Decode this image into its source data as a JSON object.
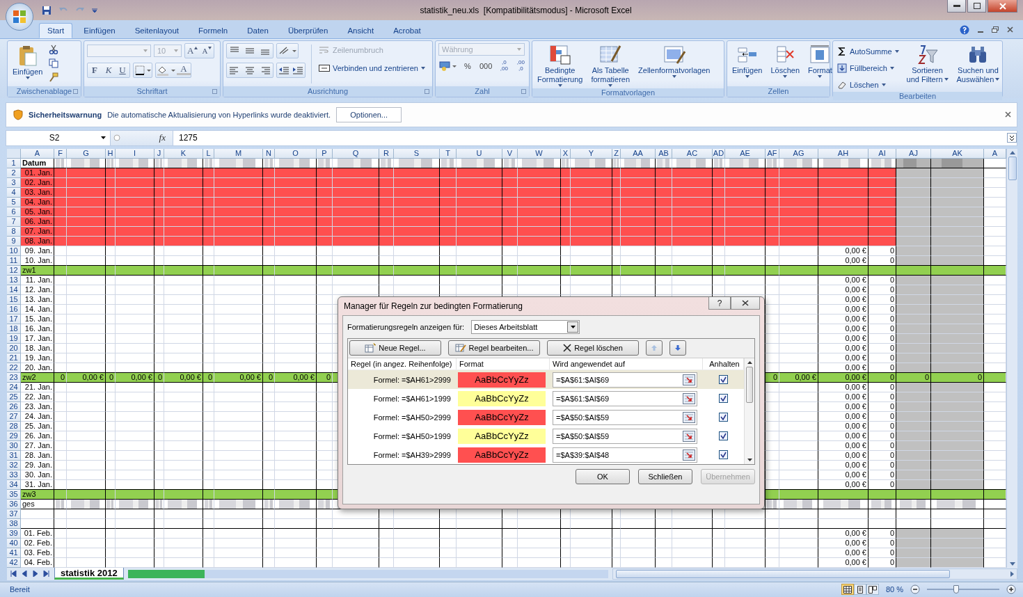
{
  "window": {
    "title": "statistik_neu.xls  [Kompatibilitätsmodus] - Microsoft Excel"
  },
  "ribbon": {
    "tabs": [
      {
        "label": "Start",
        "selected": true
      },
      {
        "label": "Einfügen",
        "selected": false
      },
      {
        "label": "Seitenlayout",
        "selected": false
      },
      {
        "label": "Formeln",
        "selected": false
      },
      {
        "label": "Daten",
        "selected": false
      },
      {
        "label": "Überprüfen",
        "selected": false
      },
      {
        "label": "Ansicht",
        "selected": false
      },
      {
        "label": "Acrobat",
        "selected": false
      }
    ],
    "clipboard": {
      "paste": "Einfügen",
      "label": "Zwischenablage"
    },
    "font": {
      "size": "10",
      "grow": "A",
      "shrink": "A",
      "bold": "F",
      "italic": "K",
      "underline": "U",
      "font_color": "A",
      "label": "Schriftart"
    },
    "alignment": {
      "wrap": {
        "label": "Zeilenumbruch",
        "disabled": true
      },
      "merge": {
        "label": "Verbinden und zentrieren",
        "disabled": false
      },
      "label": "Ausrichtung"
    },
    "number": {
      "format": {
        "value": "Währung",
        "disabled": true
      },
      "percent": "%",
      "thousands": "000",
      "increase_decimal": [
        ",0",
        ",00"
      ],
      "decrease_decimal": [
        ",00",
        ",0"
      ],
      "label": "Zahl"
    },
    "styles": {
      "buttons": [
        {
          "lines": [
            "Bedingte",
            "Formatierung"
          ],
          "kind": "conditional"
        },
        {
          "lines": [
            "Als Tabelle",
            "formatieren"
          ],
          "kind": "table"
        },
        {
          "lines": [
            "Zellenformatvorlagen"
          ],
          "kind": "cellstyle"
        }
      ],
      "label": "Formatvorlagen"
    },
    "cells": {
      "buttons": [
        {
          "label": "Einfügen",
          "kind": "insert"
        },
        {
          "label": "Löschen",
          "kind": "delete"
        },
        {
          "label": "Format",
          "kind": "format"
        }
      ],
      "label": "Zellen"
    },
    "editing": {
      "small": [
        {
          "label": "AutoSumme",
          "kind": "sum"
        },
        {
          "label": "Füllbereich",
          "kind": "fill"
        },
        {
          "label": "Löschen",
          "kind": "clear"
        }
      ],
      "big": [
        {
          "lines": [
            "Sortieren",
            "und Filtern"
          ],
          "kind": "sort"
        },
        {
          "lines": [
            "Suchen und",
            "Auswählen"
          ],
          "kind": "find"
        }
      ],
      "label": "Bearbeiten"
    }
  },
  "security_bar": {
    "title": "Sicherheitswarnung",
    "message": "Die automatische Aktualisierung von Hyperlinks wurde deaktiviert.",
    "button": "Optionen..."
  },
  "formula_bar": {
    "name_box": "S2",
    "function_label": "fx",
    "value": "1275"
  },
  "sheet": {
    "columns": [
      {
        "label": "A",
        "kind": "data"
      },
      {
        "label": "F",
        "kind": "data"
      },
      {
        "label": "G",
        "kind": "data"
      },
      {
        "label": "H",
        "kind": "data"
      },
      {
        "label": "I",
        "kind": "data"
      },
      {
        "label": "J",
        "kind": "data"
      },
      {
        "label": "K",
        "kind": "data"
      },
      {
        "label": "L",
        "kind": "data"
      },
      {
        "label": "M",
        "kind": "data"
      },
      {
        "label": "N",
        "kind": "data"
      },
      {
        "label": "O",
        "kind": "data"
      },
      {
        "label": "P",
        "kind": "data"
      },
      {
        "label": "Q",
        "kind": "data"
      },
      {
        "label": "R",
        "kind": "data"
      },
      {
        "label": "S",
        "kind": "data"
      },
      {
        "label": "T",
        "kind": "data"
      },
      {
        "label": "U",
        "kind": "data"
      },
      {
        "label": "V",
        "kind": "data"
      },
      {
        "label": "W",
        "kind": "data"
      },
      {
        "label": "X",
        "kind": "data"
      },
      {
        "label": "Y",
        "kind": "data"
      },
      {
        "label": "Z",
        "kind": "data"
      },
      {
        "label": "AA",
        "kind": "data"
      },
      {
        "label": "AB",
        "kind": "data"
      },
      {
        "label": "AC",
        "kind": "data"
      },
      {
        "label": "AD",
        "kind": "data"
      },
      {
        "label": "AE",
        "kind": "data"
      },
      {
        "label": "AF",
        "kind": "data"
      },
      {
        "label": "AG",
        "kind": "data"
      },
      {
        "label": "AH",
        "kind": "data"
      },
      {
        "label": "AI",
        "kind": "data"
      },
      {
        "label": "AJ",
        "kind": "shaded"
      },
      {
        "label": "AK",
        "kind": "shaded"
      },
      {
        "label": "A",
        "kind": "outside"
      }
    ],
    "rows": [
      {
        "number": "1",
        "kind": "header",
        "cells": [
          "Datum"
        ]
      },
      {
        "number": "2",
        "kind": "highlight",
        "cells": [
          "01. Jan."
        ]
      },
      {
        "number": "3",
        "kind": "highlight",
        "cells": [
          "02. Jan."
        ]
      },
      {
        "number": "4",
        "kind": "highlight",
        "cells": [
          "03. Jan."
        ]
      },
      {
        "number": "5",
        "kind": "highlight",
        "cells": [
          "04. Jan."
        ]
      },
      {
        "number": "6",
        "kind": "highlight",
        "cells": [
          "05. Jan."
        ]
      },
      {
        "number": "7",
        "kind": "highlight",
        "cells": [
          "06. Jan."
        ]
      },
      {
        "number": "8",
        "kind": "highlight",
        "cells": [
          "07. Jan."
        ]
      },
      {
        "number": "9",
        "kind": "highlight",
        "cells": [
          "08. Jan."
        ]
      },
      {
        "number": "10",
        "kind": "data",
        "cells": [
          "09. Jan.",
          "",
          "",
          "",
          "",
          "",
          "",
          "",
          "",
          "",
          "",
          "",
          "",
          "",
          "",
          "",
          "",
          "",
          "",
          "",
          "",
          "",
          "",
          "",
          "",
          "",
          "",
          "",
          "",
          "0,00 €",
          "0"
        ]
      },
      {
        "number": "11",
        "kind": "data",
        "cells": [
          "10. Jan.",
          "",
          "",
          "",
          "",
          "",
          "",
          "",
          "",
          "",
          "",
          "",
          "",
          "",
          "",
          "",
          "",
          "",
          "",
          "",
          "",
          "",
          "",
          "",
          "",
          "",
          "",
          "",
          "",
          "0,00 €",
          "0"
        ]
      },
      {
        "number": "12",
        "kind": "subtotal",
        "cells": [
          "zw1"
        ]
      },
      {
        "number": "13",
        "kind": "data",
        "cells": [
          "11. Jan.",
          "",
          "",
          "",
          "",
          "",
          "",
          "",
          "",
          "",
          "",
          "",
          "",
          "",
          "",
          "",
          "",
          "",
          "",
          "",
          "",
          "",
          "",
          "",
          "",
          "",
          "",
          "",
          "",
          "0,00 €",
          "0"
        ]
      },
      {
        "number": "14",
        "kind": "data",
        "cells": [
          "12. Jan.",
          "",
          "",
          "",
          "",
          "",
          "",
          "",
          "",
          "",
          "",
          "",
          "",
          "",
          "",
          "",
          "",
          "",
          "",
          "",
          "",
          "",
          "",
          "",
          "",
          "",
          "",
          "",
          "",
          "0,00 €",
          "0"
        ]
      },
      {
        "number": "15",
        "kind": "data",
        "cells": [
          "13. Jan.",
          "",
          "",
          "",
          "",
          "",
          "",
          "",
          "",
          "",
          "",
          "",
          "",
          "",
          "",
          "",
          "",
          "",
          "",
          "",
          "",
          "",
          "",
          "",
          "",
          "",
          "",
          "",
          "",
          "0,00 €",
          "0"
        ]
      },
      {
        "number": "16",
        "kind": "data",
        "cells": [
          "14. Jan.",
          "",
          "",
          "",
          "",
          "",
          "",
          "",
          "",
          "",
          "",
          "",
          "",
          "",
          "",
          "",
          "",
          "",
          "",
          "",
          "",
          "",
          "",
          "",
          "",
          "",
          "",
          "",
          "",
          "0,00 €",
          "0"
        ]
      },
      {
        "number": "17",
        "kind": "data",
        "cells": [
          "15. Jan.",
          "",
          "",
          "",
          "",
          "",
          "",
          "",
          "",
          "",
          "",
          "",
          "",
          "",
          "",
          "",
          "",
          "",
          "",
          "",
          "",
          "",
          "",
          "",
          "",
          "",
          "",
          "",
          "",
          "0,00 €",
          "0"
        ]
      },
      {
        "number": "18",
        "kind": "data",
        "cells": [
          "16. Jan.",
          "",
          "",
          "",
          "",
          "",
          "",
          "",
          "",
          "",
          "",
          "",
          "",
          "",
          "",
          "",
          "",
          "",
          "",
          "",
          "",
          "",
          "",
          "",
          "",
          "",
          "",
          "",
          "",
          "0,00 €",
          "0"
        ]
      },
      {
        "number": "19",
        "kind": "data",
        "cells": [
          "17. Jan.",
          "",
          "",
          "",
          "",
          "",
          "",
          "",
          "",
          "",
          "",
          "",
          "",
          "",
          "",
          "",
          "",
          "",
          "",
          "",
          "",
          "",
          "",
          "",
          "",
          "",
          "",
          "",
          "",
          "0,00 €",
          "0"
        ]
      },
      {
        "number": "20",
        "kind": "data",
        "cells": [
          "18. Jan.",
          "",
          "",
          "",
          "",
          "",
          "",
          "",
          "",
          "",
          "",
          "",
          "",
          "",
          "",
          "",
          "",
          "",
          "",
          "",
          "",
          "",
          "",
          "",
          "",
          "",
          "",
          "",
          "",
          "0,00 €",
          "0"
        ]
      },
      {
        "number": "21",
        "kind": "data",
        "cells": [
          "19. Jan.",
          "",
          "",
          "",
          "",
          "",
          "",
          "",
          "",
          "",
          "",
          "",
          "",
          "",
          "",
          "",
          "",
          "",
          "",
          "",
          "",
          "",
          "",
          "",
          "",
          "",
          "",
          "",
          "",
          "0,00 €",
          "0"
        ]
      },
      {
        "number": "22",
        "kind": "data",
        "cells": [
          "20. Jan.",
          "",
          "",
          "",
          "",
          "",
          "",
          "",
          "",
          "",
          "",
          "",
          "",
          "",
          "",
          "",
          "",
          "",
          "",
          "",
          "",
          "",
          "",
          "",
          "",
          "",
          "",
          "",
          "",
          "0,00 €",
          "0"
        ]
      },
      {
        "number": "23",
        "kind": "subtotal",
        "cells": [
          "zw2",
          "0",
          "0,00 €",
          "0",
          "0,00 €",
          "0",
          "0,00 €",
          "0",
          "0,00 €",
          "0",
          "0,00 €",
          "0",
          "",
          "",
          "",
          "",
          "",
          "",
          "",
          "",
          "",
          "",
          "",
          "",
          "",
          "",
          "",
          "0",
          "0,00 €",
          "0,00 €",
          "0",
          "0",
          "0"
        ]
      },
      {
        "number": "24",
        "kind": "data",
        "cells": [
          "21. Jan.",
          "",
          "",
          "",
          "",
          "",
          "",
          "",
          "",
          "",
          "",
          "",
          "",
          "",
          "",
          "",
          "",
          "",
          "",
          "",
          "",
          "",
          "",
          "",
          "",
          "",
          "",
          "",
          "",
          "0,00 €",
          "0"
        ]
      },
      {
        "number": "25",
        "kind": "data",
        "cells": [
          "22. Jan.",
          "",
          "",
          "",
          "",
          "",
          "",
          "",
          "",
          "",
          "",
          "",
          "",
          "",
          "",
          "",
          "",
          "",
          "",
          "",
          "",
          "",
          "",
          "",
          "",
          "",
          "",
          "",
          "",
          "0,00 €",
          "0"
        ]
      },
      {
        "number": "26",
        "kind": "data",
        "cells": [
          "23. Jan.",
          "",
          "",
          "",
          "",
          "",
          "",
          "",
          "",
          "",
          "",
          "",
          "",
          "",
          "",
          "",
          "",
          "",
          "",
          "",
          "",
          "",
          "",
          "",
          "",
          "",
          "",
          "",
          "",
          "0,00 €",
          "0"
        ]
      },
      {
        "number": "27",
        "kind": "data",
        "cells": [
          "24. Jan.",
          "",
          "",
          "",
          "",
          "",
          "",
          "",
          "",
          "",
          "",
          "",
          "",
          "",
          "",
          "",
          "",
          "",
          "",
          "",
          "",
          "",
          "",
          "",
          "",
          "",
          "",
          "",
          "",
          "0,00 €",
          "0"
        ]
      },
      {
        "number": "28",
        "kind": "data",
        "cells": [
          "25. Jan.",
          "",
          "",
          "",
          "",
          "",
          "",
          "",
          "",
          "",
          "",
          "",
          "",
          "",
          "",
          "",
          "",
          "",
          "",
          "",
          "",
          "",
          "",
          "",
          "",
          "",
          "",
          "",
          "",
          "0,00 €",
          "0"
        ]
      },
      {
        "number": "29",
        "kind": "data",
        "cells": [
          "26. Jan.",
          "",
          "",
          "",
          "",
          "",
          "",
          "",
          "",
          "",
          "",
          "",
          "",
          "",
          "",
          "",
          "",
          "",
          "",
          "",
          "",
          "",
          "",
          "",
          "",
          "",
          "",
          "",
          "",
          "0,00 €",
          "0"
        ]
      },
      {
        "number": "30",
        "kind": "data",
        "cells": [
          "27. Jan.",
          "",
          "",
          "",
          "",
          "",
          "",
          "",
          "",
          "",
          "",
          "",
          "",
          "",
          "",
          "",
          "",
          "",
          "",
          "",
          "",
          "",
          "",
          "",
          "",
          "",
          "",
          "",
          "",
          "0,00 €",
          "0"
        ]
      },
      {
        "number": "31",
        "kind": "data",
        "cells": [
          "28. Jan.",
          "",
          "",
          "",
          "",
          "",
          "",
          "",
          "",
          "",
          "",
          "",
          "",
          "",
          "",
          "",
          "",
          "",
          "",
          "",
          "",
          "",
          "",
          "",
          "",
          "",
          "",
          "",
          "",
          "0,00 €",
          "0"
        ]
      },
      {
        "number": "32",
        "kind": "data",
        "cells": [
          "29. Jan.",
          "",
          "",
          "",
          "",
          "",
          "",
          "",
          "",
          "",
          "",
          "",
          "",
          "",
          "",
          "",
          "",
          "",
          "",
          "",
          "",
          "",
          "",
          "",
          "",
          "",
          "",
          "",
          "",
          "0,00 €",
          "0"
        ]
      },
      {
        "number": "33",
        "kind": "data",
        "cells": [
          "30. Jan.",
          "",
          "",
          "",
          "",
          "",
          "",
          "",
          "",
          "",
          "",
          "",
          "",
          "",
          "",
          "",
          "",
          "",
          "",
          "",
          "",
          "",
          "",
          "",
          "",
          "",
          "",
          "",
          "",
          "0,00 €",
          "0"
        ]
      },
      {
        "number": "34",
        "kind": "data",
        "cells": [
          "31. Jan.",
          "",
          "",
          "",
          "",
          "",
          "",
          "",
          "",
          "",
          "",
          "",
          "",
          "",
          "",
          "",
          "",
          "",
          "",
          "",
          "",
          "",
          "",
          "",
          "",
          "",
          "",
          "",
          "",
          "0,00 €",
          "0"
        ]
      },
      {
        "number": "35",
        "kind": "subtotal",
        "cells": [
          "zw3"
        ]
      },
      {
        "number": "36",
        "kind": "total",
        "cells": [
          "ges"
        ]
      },
      {
        "number": "37",
        "kind": "blank",
        "cells": []
      },
      {
        "number": "38",
        "kind": "blank",
        "cells": []
      },
      {
        "number": "39",
        "kind": "data",
        "cells": [
          "01. Feb.",
          "",
          "",
          "",
          "",
          "",
          "",
          "",
          "",
          "",
          "",
          "",
          "",
          "",
          "",
          "",
          "",
          "",
          "",
          "",
          "",
          "",
          "",
          "",
          "",
          "",
          "",
          "",
          "",
          "0,00 €",
          "0"
        ]
      },
      {
        "number": "40",
        "kind": "data",
        "cells": [
          "02. Feb.",
          "",
          "",
          "",
          "",
          "",
          "",
          "",
          "",
          "",
          "",
          "",
          "",
          "",
          "",
          "",
          "",
          "",
          "",
          "",
          "",
          "",
          "",
          "",
          "",
          "",
          "",
          "",
          "",
          "0,00 €",
          "0"
        ]
      },
      {
        "number": "41",
        "kind": "data",
        "cells": [
          "03. Feb.",
          "",
          "",
          "",
          "",
          "",
          "",
          "",
          "",
          "",
          "",
          "",
          "",
          "",
          "",
          "",
          "",
          "",
          "",
          "",
          "",
          "",
          "",
          "",
          "",
          "",
          "",
          "",
          "",
          "0,00 €",
          "0"
        ]
      },
      {
        "number": "42",
        "kind": "data",
        "cells": [
          "04. Feb.",
          "",
          "",
          "",
          "",
          "",
          "",
          "",
          "",
          "",
          "",
          "",
          "",
          "",
          "",
          "",
          "",
          "",
          "",
          "",
          "",
          "",
          "",
          "",
          "",
          "",
          "",
          "",
          "",
          "0,00 €",
          "0"
        ]
      }
    ]
  },
  "sheet_tabs": [
    {
      "label": "statistik 2012",
      "selected": true
    }
  ],
  "dialog": {
    "title": "Manager für Regeln zur bedingten Formatierung",
    "help": "?",
    "scope_label": "Formatierungsregeln anzeigen für:",
    "scope_value": "Dieses Arbeitsblatt",
    "toolbar": [
      {
        "label": "Neue Regel...",
        "kind": "new"
      },
      {
        "label": "Regel bearbeiten...",
        "kind": "edit"
      },
      {
        "label": "Regel löschen",
        "kind": "delete"
      }
    ],
    "columns": [
      "Regel (in angez. Reihenfolge)",
      "Format",
      "Wird angewendet auf",
      "Anhalten"
    ],
    "rules": [
      {
        "rule": "Formel: =$AH61>2999",
        "preview": "AaBbCcYyZz",
        "color": "#ff5050",
        "range": "=$A$61:$AI$69",
        "stop": true,
        "selected": true
      },
      {
        "rule": "Formel: =$AH61>1999",
        "preview": "AaBbCcYyZz",
        "color": "#ffff99",
        "range": "=$A$61:$AI$69",
        "stop": true,
        "selected": false
      },
      {
        "rule": "Formel: =$AH50>2999",
        "preview": "AaBbCcYyZz",
        "color": "#ff5050",
        "range": "=$A$50:$AI$59",
        "stop": true,
        "selected": false
      },
      {
        "rule": "Formel: =$AH50>1999",
        "preview": "AaBbCcYyZz",
        "color": "#ffff99",
        "range": "=$A$50:$AI$59",
        "stop": true,
        "selected": false
      },
      {
        "rule": "Formel: =$AH39>2999",
        "preview": "AaBbCcYyZz",
        "color": "#ff5050",
        "range": "=$A$39:$AI$48",
        "stop": true,
        "selected": false
      }
    ],
    "buttons": [
      {
        "label": "OK",
        "disabled": false
      },
      {
        "label": "Schließen",
        "disabled": false
      },
      {
        "label": "Übernehmen",
        "disabled": true
      }
    ]
  },
  "status_bar": {
    "text": "Bereit",
    "views": [
      {
        "kind": "normal",
        "selected": true
      },
      {
        "kind": "layout",
        "selected": false
      },
      {
        "kind": "pagebreak",
        "selected": false
      }
    ],
    "zoom": "80 %",
    "level": 0.4
  }
}
